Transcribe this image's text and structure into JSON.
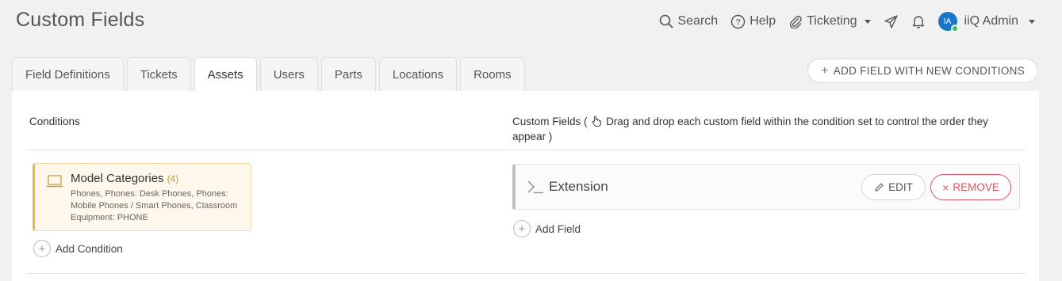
{
  "page": {
    "title": "Custom Fields"
  },
  "topbar": {
    "search_label": "Search",
    "help_label": "Help",
    "module_label": "Ticketing",
    "avatar_initials": "IA",
    "user_name": "iiQ Admin"
  },
  "tabs": [
    {
      "label": "Field Definitions",
      "active": false
    },
    {
      "label": "Tickets",
      "active": false
    },
    {
      "label": "Assets",
      "active": true
    },
    {
      "label": "Users",
      "active": false
    },
    {
      "label": "Parts",
      "active": false
    },
    {
      "label": "Locations",
      "active": false
    },
    {
      "label": "Rooms",
      "active": false
    }
  ],
  "actions": {
    "add_field_new_conditions": "ADD FIELD WITH NEW CONDITIONS"
  },
  "conditions": {
    "header": "Conditions",
    "card": {
      "title": "Model Categories",
      "count": "(4)",
      "description": "Phones, Phones: Desk Phones, Phones: Mobile Phones / Smart Phones, Classroom Equipment: PHONE"
    },
    "add_label": "Add Condition"
  },
  "custom_fields": {
    "header_prefix": "Custom Fields (",
    "header_suffix": "Drag and drop each custom field within the condition set to control the order they appear )",
    "field": {
      "name": "Extension",
      "edit_label": "EDIT",
      "remove_label": "REMOVE"
    },
    "add_label": "Add Field"
  },
  "colors": {
    "accent_blue": "#1976c9",
    "status_online": "#3bc35a",
    "remove_red": "#d9535f",
    "condition_gold": "#e9b64a"
  }
}
